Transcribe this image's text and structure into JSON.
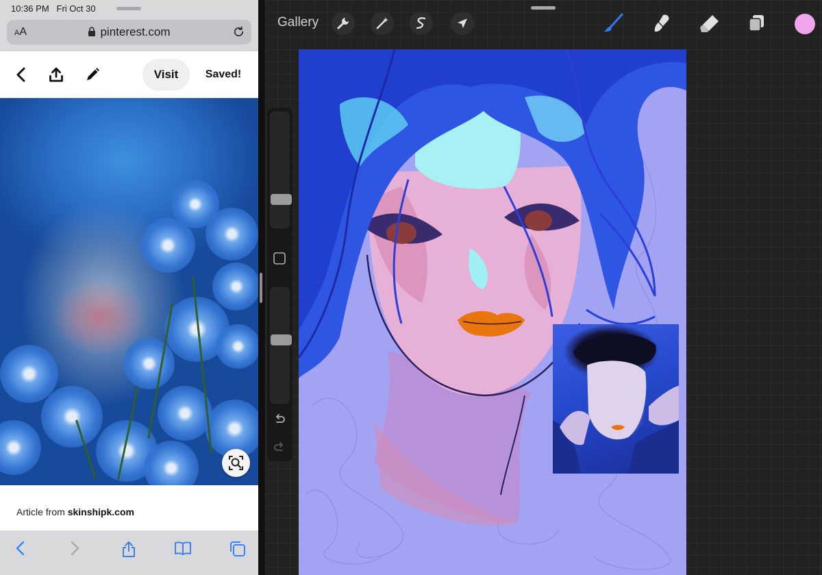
{
  "status_bar": {
    "time": "10:36 PM",
    "date": "Fri Oct 30"
  },
  "safari": {
    "address_aa": "AA",
    "domain": "pinterest.com",
    "icons": [
      "back-icon",
      "share-icon",
      "edit-icon",
      "visual-search-icon",
      "nav-back-icon",
      "nav-forward-icon",
      "safari-share-icon",
      "bookmarks-icon",
      "tabs-icon",
      "lock-icon",
      "reload-icon"
    ]
  },
  "pinterest": {
    "visit_label": "Visit",
    "saved_label": "Saved!",
    "article_prefix": "Article from ",
    "article_source": "skinshipk.com"
  },
  "procreate": {
    "gallery_label": "Gallery",
    "left_tools": [
      "wrench-icon",
      "magic-wand-icon",
      "selection-icon",
      "transform-arrow-icon"
    ],
    "right_tools": [
      "brush-icon",
      "smudge-icon",
      "eraser-icon",
      "layers-icon"
    ],
    "active_tool": "brush",
    "current_color": "#f0a4ec",
    "brush_size_level": 0.22,
    "opacity_level": 0.55
  },
  "colors": {
    "active_tool_blue": "#2e7cf6",
    "canvas_base": "#a3a3f4",
    "safari_chrome": "#d9d9db"
  }
}
